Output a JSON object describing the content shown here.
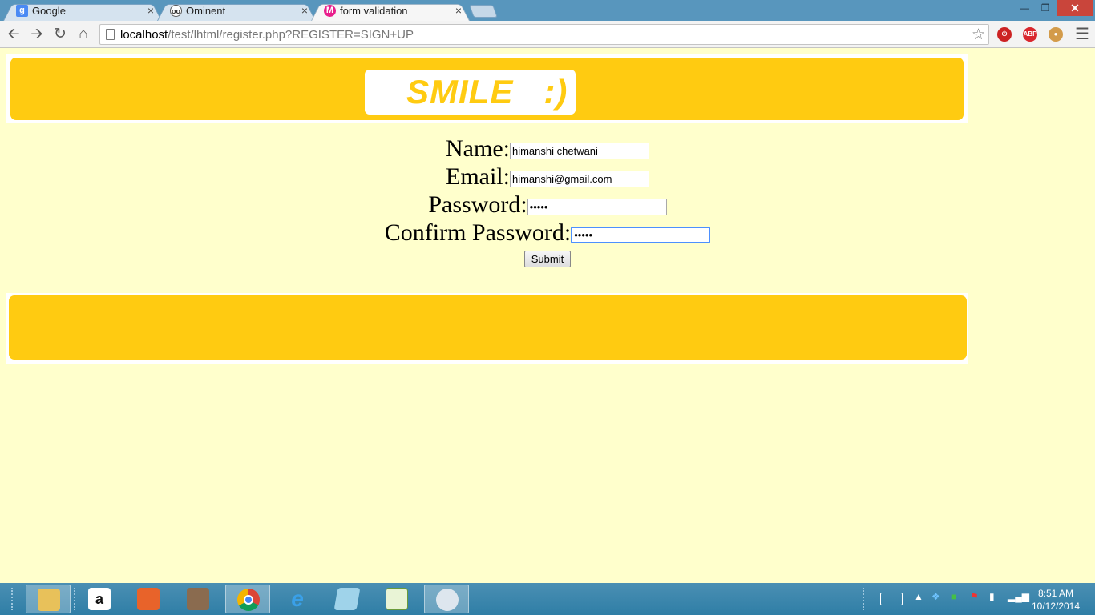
{
  "browser": {
    "tabs": [
      {
        "title": "Google",
        "favicon": "google-icon",
        "color": "#4a8af4",
        "active": false
      },
      {
        "title": "Ominent",
        "favicon": "ominent-icon",
        "color": "#333333",
        "active": false
      },
      {
        "title": "form validation",
        "favicon": "form-favicon-icon",
        "color": "#e91e8c",
        "active": true
      }
    ],
    "close_glyph": "×",
    "url_host": "localhost",
    "url_rest": "/test/lhtml/register.php?REGISTER=SIGN+UP",
    "extensions": [
      {
        "name": "power-extension-icon",
        "color": "#cc2222",
        "label": ""
      },
      {
        "name": "adblock-plus-icon",
        "color": "#d9272e",
        "label": "ABP"
      },
      {
        "name": "cookie-extension-icon",
        "color": "#d39b4a",
        "label": ""
      }
    ]
  },
  "page": {
    "logo_text": "SMILE   :)",
    "form": {
      "name_label": "Name:",
      "name_value": "himanshi chetwani",
      "email_label": "Email:",
      "email_value": "himanshi@gmail.com",
      "password_label": "Password:",
      "password_value": "12345",
      "confirm_label": "Confirm Password:",
      "confirm_value": "12345",
      "submit_label": "Submit"
    },
    "colors": {
      "background": "#ffffcc",
      "accent": "#ffcb11"
    }
  },
  "taskbar": {
    "apps": [
      "file-explorer-icon",
      "amazon-icon",
      "office-icon",
      "media-player-icon",
      "chrome-icon",
      "internet-explorer-icon",
      "notes-icon",
      "notepad-plus-icon",
      "paint-icon"
    ],
    "active_app": "chrome-icon",
    "time": "8:51 AM",
    "date": "10/12/2014"
  }
}
